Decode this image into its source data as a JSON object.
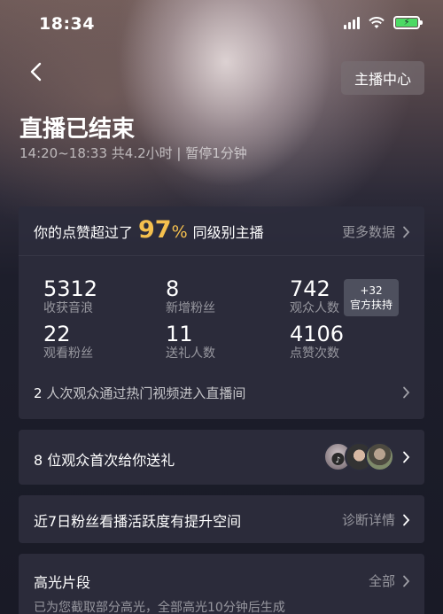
{
  "status_bar": {
    "time": "18:34"
  },
  "header": {
    "anchor_center_label": "主播中心",
    "title": "直播已结束",
    "subtitle": "14:20~18:33 共4.2小时 | 暂停1分钟"
  },
  "summary": {
    "prefix": "你的点赞超过了",
    "percent": "97",
    "percent_sign": "%",
    "suffix": "同级别主播",
    "more_label": "更多数据"
  },
  "stats": [
    {
      "value": "5312",
      "label": "收获音浪"
    },
    {
      "value": "8",
      "label": "新增粉丝"
    },
    {
      "value": "742",
      "label": "观众人数"
    },
    {
      "value": "22",
      "label": "观看粉丝"
    },
    {
      "value": "11",
      "label": "送礼人数"
    },
    {
      "value": "4106",
      "label": "点赞次数"
    }
  ],
  "official_badge": {
    "line1": "+32",
    "line2": "官方扶持"
  },
  "hot_video": {
    "count": "2",
    "text": "人次观众通过热门视频进入直播间"
  },
  "first_gift": {
    "text": "8 位观众首次给你送礼"
  },
  "fans_activity": {
    "text": "近7日粉丝看播活跃度有提升空间",
    "link": "诊断详情"
  },
  "highlights": {
    "title": "高光片段",
    "link": "全部",
    "desc": "已为您截取部分高光，全部高光10分钟后生成"
  },
  "colors": {
    "accent": "#f5c04e",
    "card_bg": "#2c2d3c",
    "battery": "#4cd964"
  }
}
